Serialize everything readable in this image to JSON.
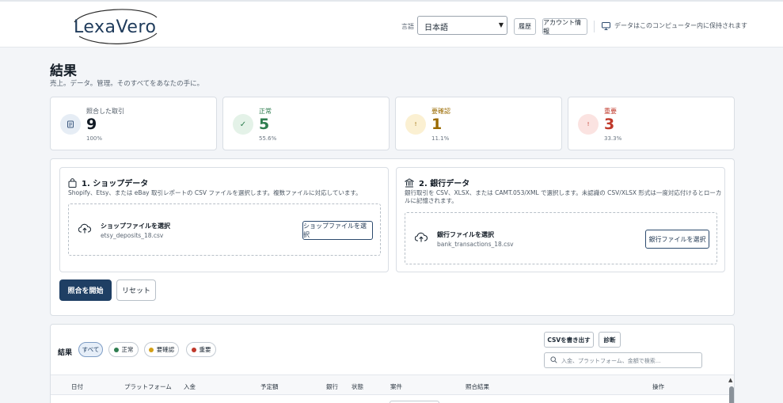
{
  "header": {
    "logo_text": "LexaVero",
    "language_label": "言語",
    "language_selected": "日本語",
    "history_button": "履歴",
    "account_button": "アカウント情報",
    "local_notice": "データはこのコンピューター内に保持されます"
  },
  "page": {
    "title": "結果",
    "subtitle": "売上。データ。管理。そのすべてをあなたの手に。"
  },
  "stats": [
    {
      "label": "照合した取引",
      "value": "9",
      "percent": "100%",
      "color": "#4a5a6e",
      "icon": "document-icon"
    },
    {
      "label": "正常",
      "value": "5",
      "percent": "55.6%",
      "color": "#2e7d4f",
      "icon": "check-icon"
    },
    {
      "label": "要確認",
      "value": "1",
      "percent": "11.1%",
      "color": "#9a6a00",
      "icon": "exclamation-icon"
    },
    {
      "label": "重要",
      "value": "3",
      "percent": "33.3%",
      "color": "#c0392b",
      "icon": "exclamation-icon"
    }
  ],
  "shop": {
    "title": "1. ショップデータ",
    "description": "Shopify、Etsy、または eBay 取引レポートの CSV ファイルを選択します。複数ファイルに対応しています。",
    "drop_title": "ショップファイルを選択",
    "file_name": "etsy_deposits_18.csv",
    "button": "ショップファイルを選択"
  },
  "bank": {
    "title": "2. 銀行データ",
    "description_line1": "銀行取引を CSV、XLSX、または CAMT.053/XML で選択します。未認識の CSV/XLSX 形式は一度対応付けるとローカ",
    "description_line2": "ルに記憶されます。",
    "drop_title": "銀行ファイルを選択",
    "file_name": "bank_transactions_18.csv",
    "button": "銀行ファイルを選択"
  },
  "actions": {
    "start": "照合を開始",
    "reset": "リセット"
  },
  "results": {
    "label": "結果",
    "filters": [
      {
        "label": "すべて",
        "active": true,
        "color": ""
      },
      {
        "label": "正常",
        "active": false,
        "color": "#2e7d4f"
      },
      {
        "label": "要確認",
        "active": false,
        "color": "#d4a017"
      },
      {
        "label": "重要",
        "active": false,
        "color": "#c0392b"
      }
    ],
    "export_csv": "CSVを書き出す",
    "diagnostics": "診断",
    "search_placeholder": "入金、プラットフォーム、金額で検索...",
    "columns": [
      "日付",
      "プラットフォーム",
      "入金",
      "予定額",
      "銀行",
      "状態",
      "案件",
      "照合結果",
      "操作"
    ]
  }
}
